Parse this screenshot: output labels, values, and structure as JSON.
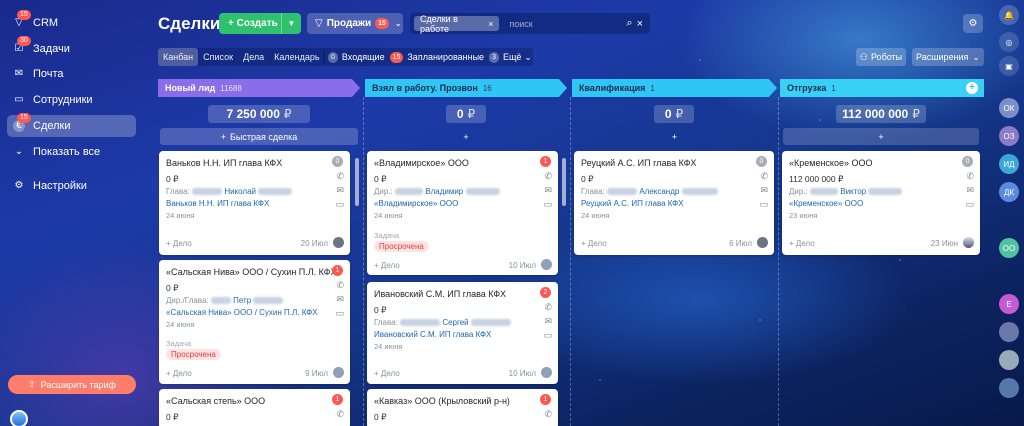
{
  "sidebar": {
    "items": [
      {
        "label": "CRM",
        "icon": "funnel-icon",
        "badge": "15"
      },
      {
        "label": "Задачи",
        "icon": "tasks-icon",
        "badge": "30"
      },
      {
        "label": "Почта",
        "icon": "mail-icon",
        "badge": ""
      },
      {
        "label": "Сотрудники",
        "icon": "employees-icon",
        "badge": ""
      },
      {
        "label": "Сделки",
        "icon": "deals-icon",
        "badge": "15"
      },
      {
        "label": "Показать все",
        "icon": "chevron-down-icon",
        "badge": ""
      },
      {
        "label": "Настройки",
        "icon": "gear-icon",
        "badge": ""
      }
    ],
    "upgrade_label": "Расширить тариф"
  },
  "header": {
    "title": "Сделки",
    "create_label": "Создать",
    "funnel_label": "Продажи",
    "funnel_badge": "15",
    "filter_chip": "Сделки в работе",
    "search_placeholder": "поиск"
  },
  "toolbar": {
    "views": [
      "Канбан",
      "Список",
      "Дела",
      "Календарь"
    ],
    "counters": [
      {
        "count": "0",
        "label": "Входящие"
      },
      {
        "count": "15",
        "label": "Запланированные"
      },
      {
        "count": "3",
        "label": "Ещё"
      }
    ],
    "robots_label": "Роботы",
    "extensions_label": "Расширения"
  },
  "rail": {
    "items": [
      "ОК",
      "ОЗ",
      "ИД",
      "ДК",
      "ОО",
      "Е"
    ]
  },
  "columns": [
    {
      "title": "Новый лид",
      "count": "11688",
      "sum": "7 250 000",
      "currency": "₽",
      "color": "#8a6de8",
      "add_label": "Быстрая сделка"
    },
    {
      "title": "Взял в работу. Прозвон",
      "count": "16",
      "sum": "0",
      "currency": "₽",
      "color": "#2fc6f6",
      "add_label": "+"
    },
    {
      "title": "Квалификация",
      "count": "1",
      "sum": "0",
      "currency": "₽",
      "color": "#2fc6f6",
      "add_label": "+"
    },
    {
      "title": "Отгрузка",
      "count": "1",
      "sum": "112 000 000",
      "currency": "₽",
      "color": "#39d0f5",
      "add_label": "+"
    }
  ],
  "cards": [
    {
      "title": "Ваньков Н.Н. ИП глава КФХ",
      "num": "0",
      "amount": "0 ₽",
      "role": "Глава:",
      "person": "Николай",
      "company": "Ваньков Н.Н. ИП глава КФХ",
      "date": "24 июня",
      "add": "+ Дело",
      "due": "20 Июл"
    },
    {
      "title": "«Сальская Нива» ООО / Сухин П.Л. КФХ",
      "num": "1",
      "amount": "0 ₽",
      "role": "Дир./Глава:",
      "person": "Петр",
      "company": "«Сальская Нива» ООО / Сухин П.Л. КФХ",
      "date": "24 июня",
      "task": "Задача",
      "status": "Просрочена",
      "add": "+ Дело",
      "due": "9 Июл"
    },
    {
      "title": "«Сальская степь» ООО",
      "num": "1",
      "amount": "0 ₽"
    },
    {
      "title": "«Владимирское» ООО",
      "num": "1",
      "amount": "0 ₽",
      "role": "Дир.:",
      "person": "Владимир",
      "company": "«Владимирское» ООО",
      "date": "24 июня",
      "task": "Задача",
      "status": "Просрочена",
      "add": "+ Дело",
      "due": "10 Июл"
    },
    {
      "title": "Ивановский С.М. ИП глава КФХ",
      "num": "2",
      "amount": "0 ₽",
      "role": "Глава:",
      "person": "Сергей",
      "company": "Ивановский С.М. ИП глава КФХ",
      "date": "24 июня",
      "add": "+ Дело",
      "due": "10 Июл"
    },
    {
      "title": "«Кавказ» ООО (Крыловский р-н)",
      "num": "1",
      "amount": "0 ₽"
    },
    {
      "title": "Реуцкий А.С. ИП глава КФХ",
      "num": "0",
      "amount": "0 ₽",
      "role": "Глава:",
      "person": "Александр",
      "company": "Реуцкий А.С. ИП глава КФХ",
      "date": "24 июня",
      "add": "+ Дело",
      "due": "6 Июл"
    },
    {
      "title": "«Кременское» ООО",
      "num": "0",
      "amount": "112 000 000 ₽",
      "role": "Дир.:",
      "person": "Виктор",
      "company": "«Кременское» ООО",
      "date": "23 июня",
      "add": "+ Дело",
      "due": "23 Июн"
    }
  ],
  "colors": {
    "accent_green": "#2fc26e",
    "badge_red": "#ff5752",
    "stage_purple": "#8a6de8",
    "stage_cyan": "#2fc6f6"
  }
}
